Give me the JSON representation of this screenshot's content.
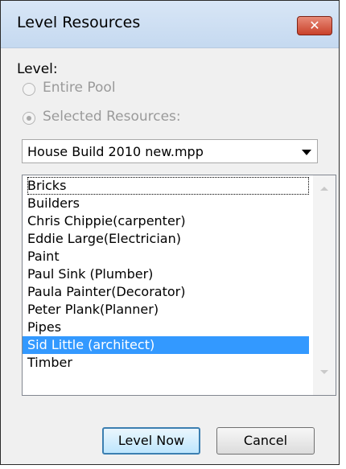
{
  "window": {
    "title": "Level Resources",
    "close_label": "✕"
  },
  "level_label": "Level:",
  "options": [
    {
      "label": "Entire Pool",
      "selected": false
    },
    {
      "label": "Selected Resources:",
      "selected": true
    }
  ],
  "project": {
    "value": "House Build 2010 new.mpp"
  },
  "resources": [
    {
      "label": "Bricks"
    },
    {
      "label": "Builders"
    },
    {
      "label": "Chris Chippie(carpenter)"
    },
    {
      "label": "Eddie Large(Electrician)"
    },
    {
      "label": "Paint"
    },
    {
      "label": "Paul Sink (Plumber)"
    },
    {
      "label": "Paula Painter(Decorator)"
    },
    {
      "label": "Peter Plank(Planner)"
    },
    {
      "label": "Pipes"
    },
    {
      "label": "Sid Little (architect)"
    },
    {
      "label": "Timber"
    }
  ],
  "buttons": {
    "level_now": "Level Now",
    "cancel": "Cancel"
  },
  "colors": {
    "selection": "#3399ff",
    "titlebar": "#c5d9f0",
    "close": "#c9412a"
  }
}
